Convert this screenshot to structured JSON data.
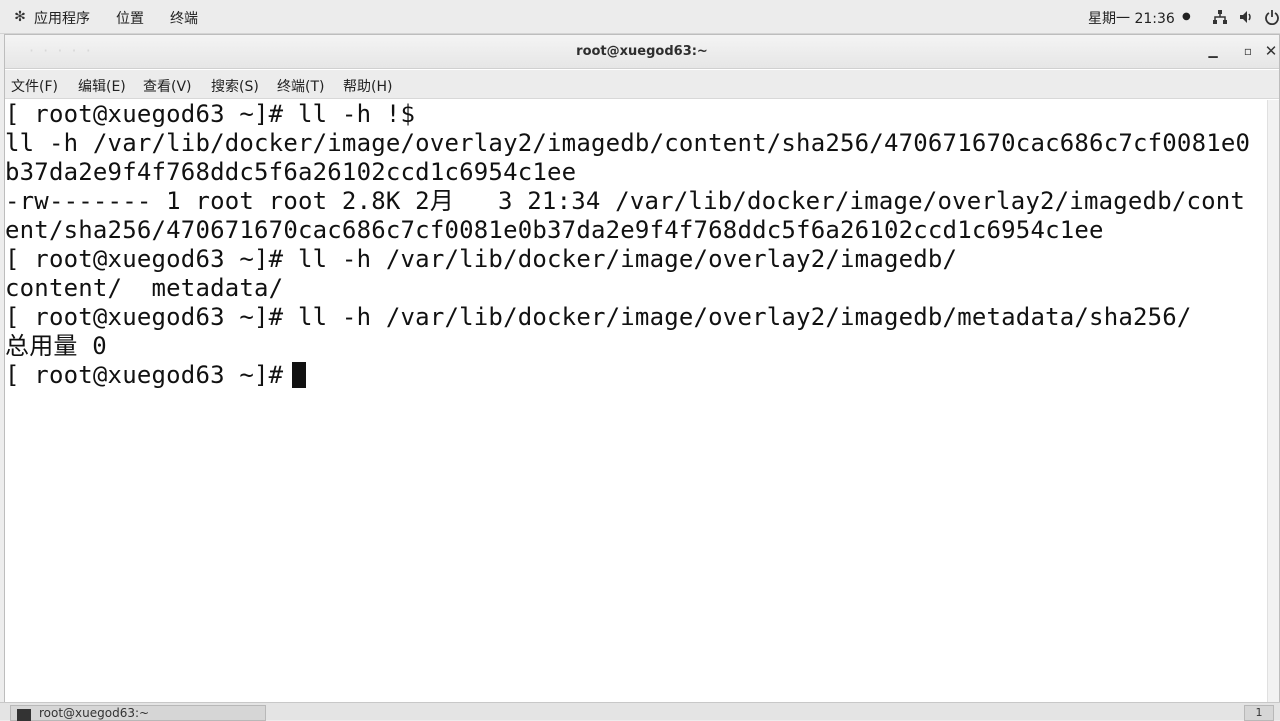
{
  "top_panel": {
    "applications_label": "应用程序",
    "places_label": "位置",
    "terminal_label": "终端",
    "clock": "星期一 21:36",
    "clock_dot": "●"
  },
  "window": {
    "title": "root@xuegod63:~",
    "ghost_text": "· ·  ·  ·  ·"
  },
  "menubar": {
    "file": "文件(F)",
    "edit": "编辑(E)",
    "view": "查看(V)",
    "search": "搜索(S)",
    "terminal": "终端(T)",
    "help": "帮助(H)"
  },
  "terminal": {
    "lines": [
      "[ root@xuegod63 ~]# ll -h !$",
      "ll -h /var/lib/docker/image/overlay2/imagedb/content/sha256/470671670cac686c7cf0081e0",
      "b37da2e9f4f768ddc5f6a26102ccd1c6954c1ee",
      "-rw------- 1 root root 2.8K 2月   3 21:34 /var/lib/docker/image/overlay2/imagedb/cont",
      "ent/sha256/470671670cac686c7cf0081e0b37da2e9f4f768ddc5f6a26102ccd1c6954c1ee",
      "[ root@xuegod63 ~]# ll -h /var/lib/docker/image/overlay2/imagedb/",
      "content/  metadata/",
      "[ root@xuegod63 ~]# ll -h /var/lib/docker/image/overlay2/imagedb/metadata/sha256/",
      "总用量 0",
      "[ root@xuegod63 ~]# "
    ]
  },
  "taskbar": {
    "task_label": "root@xuegod63:~",
    "workspace": "1"
  }
}
